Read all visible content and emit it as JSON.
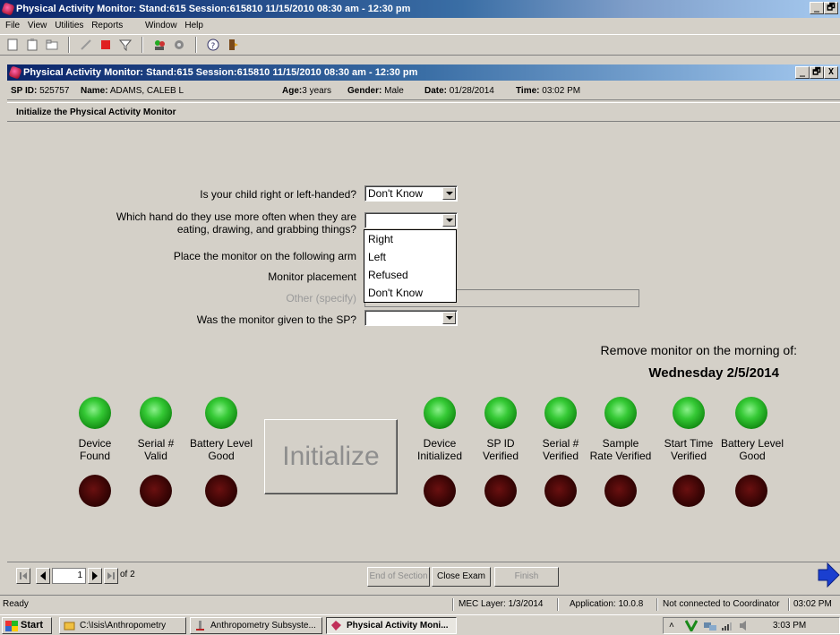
{
  "window": {
    "title": "Physical Activity Monitor: Stand:615 Session:615810 11/15/2010 08:30 am - 12:30 pm",
    "controls": [
      "_",
      "🗗",
      "X"
    ]
  },
  "menu": [
    "File",
    "View",
    "Utilities",
    "Reports",
    "Window",
    "Help"
  ],
  "inner_window": {
    "title": "Physical Activity Monitor: Stand:615 Session:615810 11/15/2010 08:30 am - 12:30 pm"
  },
  "info": {
    "sp_id_label": "SP ID:",
    "sp_id": "525757",
    "name_label": "Name:",
    "name": "ADAMS, CALEB L",
    "age_label": "Age:",
    "age": "3 years",
    "gender_label": "Gender:",
    "gender": "Male",
    "date_label": "Date:",
    "date": "01/28/2014",
    "time_label": "Time:",
    "time": "03:02 PM"
  },
  "section_title": "Initialize the Physical Activity Monitor",
  "form": {
    "q1": "Is your child right or left-handed?",
    "q1_value": "Don't Know",
    "q2_line1": "Which hand do they use more often when they are",
    "q2_line2": "eating, drawing, and grabbing things?",
    "q2_value": "",
    "q3": "Place the monitor on the following arm",
    "q4": "Monitor placement",
    "q5": "Other (specify)",
    "q6": "Was the monitor given to the SP?",
    "q6_value": "",
    "dropdown_options": [
      "Right",
      "Left",
      "Refused",
      "Don't Know"
    ]
  },
  "removal": {
    "label": "Remove monitor on the morning of:",
    "date": "Wednesday 2/5/2014"
  },
  "indicators_left": [
    {
      "line1": "Device",
      "line2": "Found"
    },
    {
      "line1": "Serial #",
      "line2": "Valid"
    },
    {
      "line1": "Battery Level",
      "line2": "Good"
    }
  ],
  "indicators_right": [
    {
      "line1": "Device",
      "line2": "Initialized"
    },
    {
      "line1": "SP ID",
      "line2": "Verified"
    },
    {
      "line1": "Serial #",
      "line2": "Verified"
    },
    {
      "line1": "Sample",
      "line2": "Rate Verified"
    },
    {
      "line1": "Start Time",
      "line2": "Verified"
    },
    {
      "line1": "Battery Level",
      "line2": "Good"
    }
  ],
  "initialize_label": "Initialize",
  "nav": {
    "page": "1",
    "of_label": "of 2",
    "end_of_section": "End of Section",
    "close_exam": "Close Exam",
    "finish": "Finish"
  },
  "status": {
    "ready": "Ready",
    "mec_layer": "MEC Layer: 1/3/2014",
    "application": "Application: 10.0.8",
    "coordinator": "Not connected to Coordinator",
    "time": "03:02 PM"
  },
  "taskbar": {
    "start": "Start",
    "tasks": [
      "C:\\Isis\\Anthropometry",
      "Anthropometry Subsyste...",
      "Physical Activity Moni..."
    ],
    "clock": "3:03 PM"
  },
  "colors": {
    "title_dark": "#0a246a",
    "face": "#d4d0c8",
    "led_on": "#35c935",
    "led_off": "#3a0505"
  }
}
